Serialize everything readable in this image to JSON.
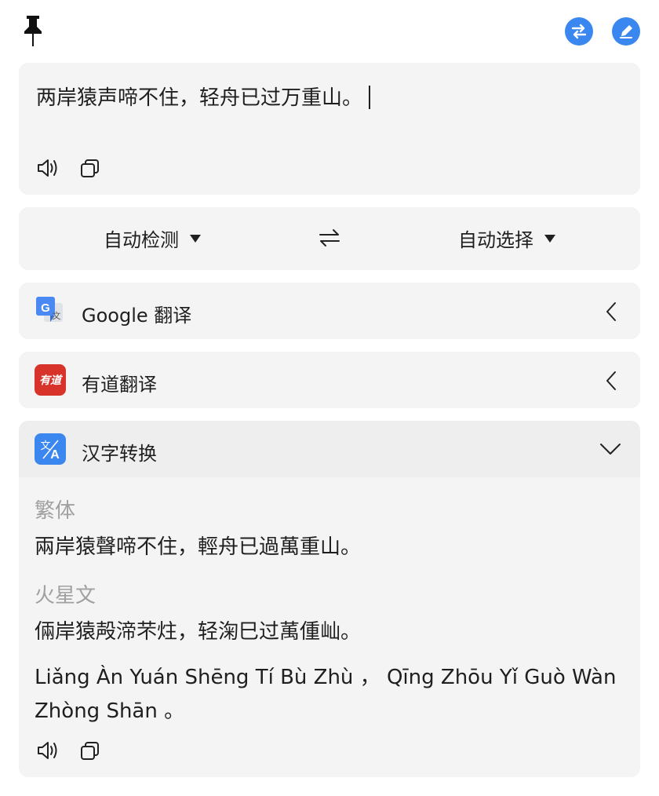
{
  "toolbar": {
    "pin_icon": "pin-icon",
    "swap_icon": "swap-icon",
    "edit_icon": "pencil-icon",
    "accent_color": "#3b87f0"
  },
  "source": {
    "text": "两岸猿声啼不住，轻舟已过万重山。"
  },
  "language_bar": {
    "from": "自动检测",
    "to": "自动选择"
  },
  "services": [
    {
      "name": "Google 翻译",
      "logo_text": "G",
      "logo_sub": "文",
      "expanded": false
    },
    {
      "name": "有道翻译",
      "logo_text": "有道",
      "expanded": false,
      "color": "#d8332a"
    },
    {
      "name": "汉字转换",
      "logo_text": "文A",
      "expanded": true,
      "color": "#3b87f0"
    }
  ],
  "conversion": {
    "traditional_label": "繁体",
    "traditional_text": "兩岸猿聲啼不住，輕舟已過萬重山。",
    "martian_label": "火星文",
    "martian_text": "倆岸猿殸渧芣炷，轻淗巳过萭偅屾。",
    "pinyin_text": "Liǎng Àn Yuán Shēng Tí Bù Zhù ，  Qīng Zhōu Yǐ Guò Wàn Zhòng Shān 。"
  }
}
